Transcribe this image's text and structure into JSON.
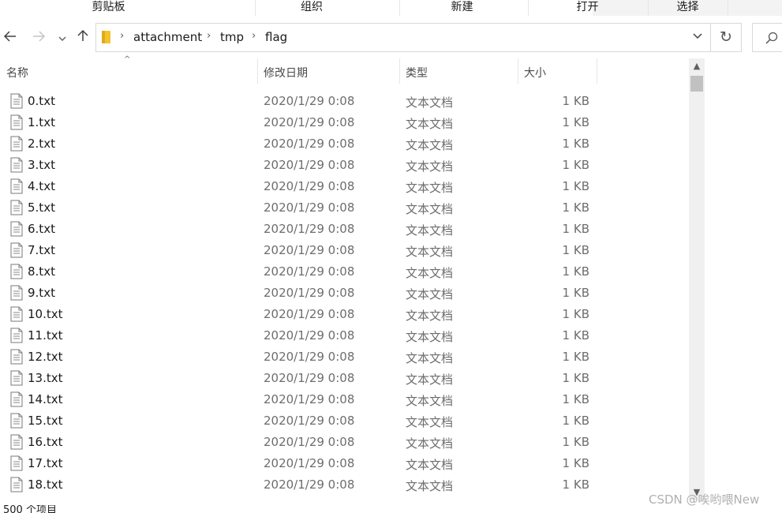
{
  "ribbon": {
    "groups": [
      "剪贴板",
      "组织",
      "新建",
      "打开",
      "选择"
    ]
  },
  "nav": {
    "back_icon": "arrow-left-icon",
    "forward_icon": "arrow-right-icon",
    "recent_icon": "chevron-down-icon",
    "up_icon": "arrow-up-icon"
  },
  "address": {
    "breadcrumbs": [
      "attachment",
      "tmp",
      "flag"
    ],
    "folder_color": "#f3c22f"
  },
  "columns": {
    "name": "名称",
    "date": "修改日期",
    "type": "类型",
    "size": "大小"
  },
  "files": [
    {
      "name": "0.txt",
      "date": "2020/1/29 0:08",
      "type": "文本文档",
      "size": "1 KB"
    },
    {
      "name": "1.txt",
      "date": "2020/1/29 0:08",
      "type": "文本文档",
      "size": "1 KB"
    },
    {
      "name": "2.txt",
      "date": "2020/1/29 0:08",
      "type": "文本文档",
      "size": "1 KB"
    },
    {
      "name": "3.txt",
      "date": "2020/1/29 0:08",
      "type": "文本文档",
      "size": "1 KB"
    },
    {
      "name": "4.txt",
      "date": "2020/1/29 0:08",
      "type": "文本文档",
      "size": "1 KB"
    },
    {
      "name": "5.txt",
      "date": "2020/1/29 0:08",
      "type": "文本文档",
      "size": "1 KB"
    },
    {
      "name": "6.txt",
      "date": "2020/1/29 0:08",
      "type": "文本文档",
      "size": "1 KB"
    },
    {
      "name": "7.txt",
      "date": "2020/1/29 0:08",
      "type": "文本文档",
      "size": "1 KB"
    },
    {
      "name": "8.txt",
      "date": "2020/1/29 0:08",
      "type": "文本文档",
      "size": "1 KB"
    },
    {
      "name": "9.txt",
      "date": "2020/1/29 0:08",
      "type": "文本文档",
      "size": "1 KB"
    },
    {
      "name": "10.txt",
      "date": "2020/1/29 0:08",
      "type": "文本文档",
      "size": "1 KB"
    },
    {
      "name": "11.txt",
      "date": "2020/1/29 0:08",
      "type": "文本文档",
      "size": "1 KB"
    },
    {
      "name": "12.txt",
      "date": "2020/1/29 0:08",
      "type": "文本文档",
      "size": "1 KB"
    },
    {
      "name": "13.txt",
      "date": "2020/1/29 0:08",
      "type": "文本文档",
      "size": "1 KB"
    },
    {
      "name": "14.txt",
      "date": "2020/1/29 0:08",
      "type": "文本文档",
      "size": "1 KB"
    },
    {
      "name": "15.txt",
      "date": "2020/1/29 0:08",
      "type": "文本文档",
      "size": "1 KB"
    },
    {
      "name": "16.txt",
      "date": "2020/1/29 0:08",
      "type": "文本文档",
      "size": "1 KB"
    },
    {
      "name": "17.txt",
      "date": "2020/1/29 0:08",
      "type": "文本文档",
      "size": "1 KB"
    },
    {
      "name": "18.txt",
      "date": "2020/1/29 0:08",
      "type": "文本文档",
      "size": "1 KB"
    }
  ],
  "status": {
    "item_count": "500 个项目"
  },
  "watermark": "CSDN @唉哟喂New"
}
